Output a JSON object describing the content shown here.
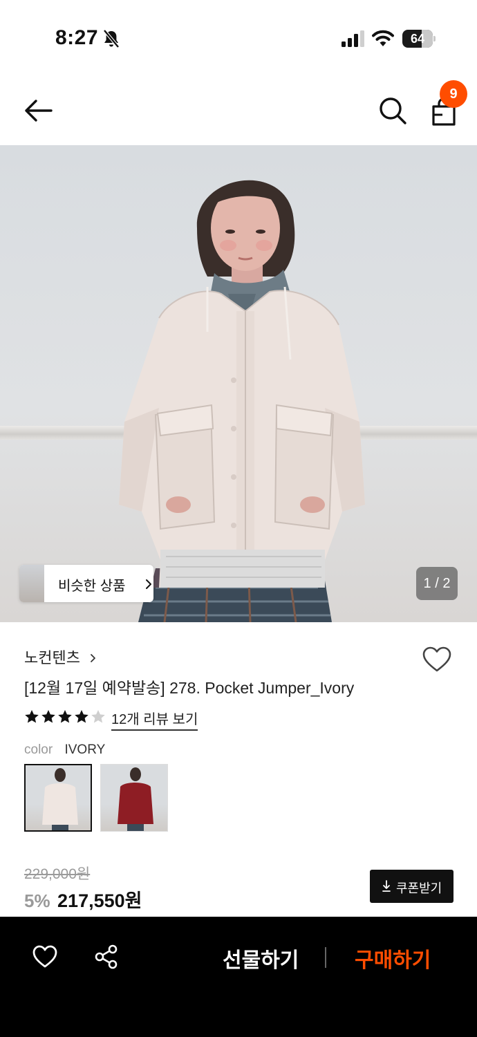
{
  "status_bar": {
    "time": "8:27",
    "battery": "64",
    "battery_level": 0.64,
    "icons": [
      "bell-slash-icon",
      "cellular-signal-icon",
      "wifi-icon",
      "battery-icon"
    ]
  },
  "header": {
    "cart_count": "9",
    "icons": [
      "back-arrow-icon",
      "search-icon",
      "shopping-bag-icon"
    ],
    "badge_color": "#ff4d00"
  },
  "gallery": {
    "similar_label": "비슷한 상품",
    "counter": "1 / 2",
    "current": 1,
    "total": 2
  },
  "product": {
    "brand": "노컨텐츠",
    "title": "[12월 17일 예약발송] 278. Pocket Jumper_Ivory",
    "rating": 4.5,
    "review_link": "12개 리뷰 보기",
    "color_label": "color",
    "color_value": "IVORY",
    "swatches": [
      {
        "name": "IVORY",
        "color": "#efe6e1",
        "selected": true
      },
      {
        "name": "RED",
        "color": "#8e1d24",
        "selected": false
      }
    ]
  },
  "price": {
    "original": "229,000원",
    "discount": "5%",
    "final": "217,550원",
    "coupon_label": "쿠폰받기"
  },
  "bottom_bar": {
    "gift_label": "선물하기",
    "buy_label": "구매하기",
    "buy_color": "#ff4d00",
    "icons": [
      "heart-icon",
      "share-icon"
    ]
  }
}
